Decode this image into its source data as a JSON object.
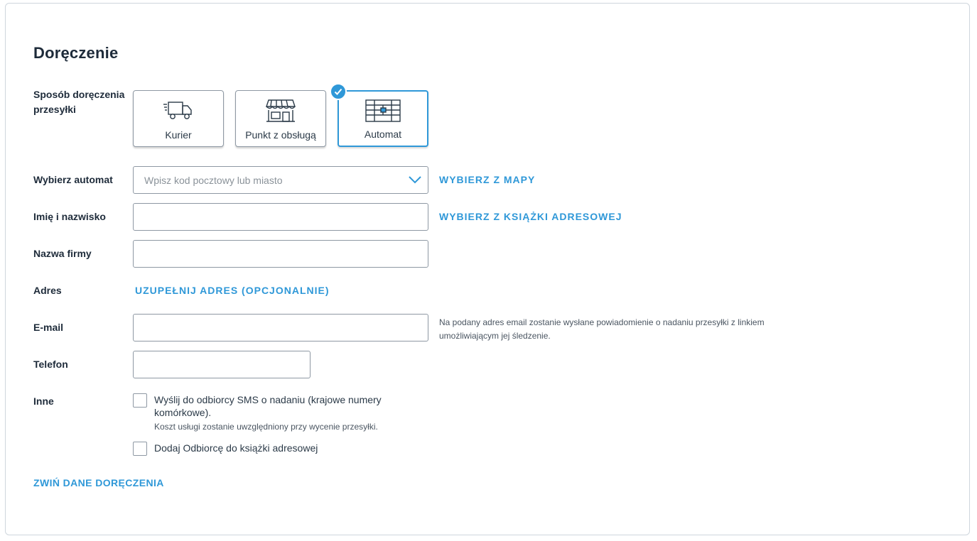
{
  "section": {
    "title": "Doręczenie",
    "collapse_link": "ZWIŃ DANE DORĘCZENIA"
  },
  "delivery_method": {
    "label": "Sposób doręczenia przesyłki",
    "options": [
      {
        "label": "Kurier",
        "icon": "truck-icon",
        "selected": false
      },
      {
        "label": "Punkt z obsługą",
        "icon": "shop-icon",
        "selected": false
      },
      {
        "label": "Automat",
        "icon": "parcel-locker-icon",
        "selected": true
      }
    ]
  },
  "locker": {
    "label": "Wybierz automat",
    "placeholder": "Wpisz kod pocztowy lub miasto",
    "value": "",
    "map_link": "WYBIERZ Z MAPY"
  },
  "name": {
    "label": "Imię i nazwisko",
    "value": "",
    "address_book_link": "WYBIERZ Z KSIĄŻKI ADRESOWEJ"
  },
  "company": {
    "label": "Nazwa firmy",
    "value": ""
  },
  "address": {
    "label": "Adres",
    "link": "UZUPEŁNIJ ADRES (OPCJONALNIE)"
  },
  "email": {
    "label": "E-mail",
    "value": "",
    "hint": "Na podany adres email zostanie wysłane powiadomienie o nadaniu przesyłki z linkiem umożliwiającym jej śledzenie."
  },
  "phone": {
    "label": "Telefon",
    "value": ""
  },
  "other": {
    "label": "Inne",
    "sms_label": "Wyślij do odbiorcy SMS o nadaniu (krajowe numery komórkowe).",
    "sms_note": "Koszt usługi zostanie uwzględniony przy wycenie przesyłki.",
    "sms_checked": false,
    "add_to_book_label": "Dodaj Odbiorcę do książki adresowej",
    "add_to_book_checked": false
  },
  "colors": {
    "accent": "#2f98d8",
    "text": "#1e2b3a",
    "border": "#8e98a3"
  }
}
